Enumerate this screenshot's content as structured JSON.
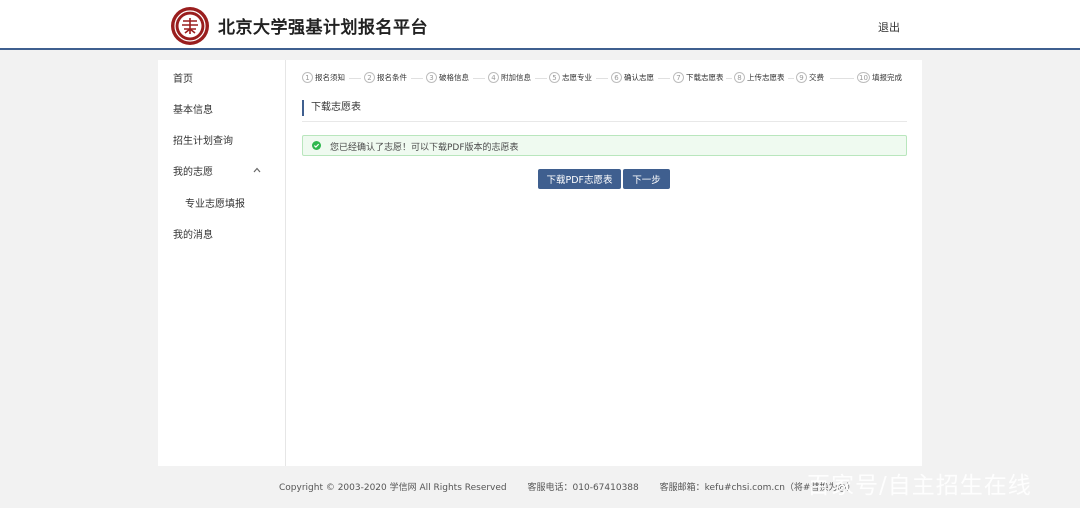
{
  "header": {
    "logo_icon": "pku-seal-icon",
    "title": "北京大学强基计划报名平台",
    "logout_label": "退出",
    "brand_color": "#3f5f8f",
    "seal_color": "#9a1e1e"
  },
  "sidebar": {
    "items": [
      {
        "label": "首页"
      },
      {
        "label": "基本信息"
      },
      {
        "label": "招生计划查询"
      },
      {
        "label": "我的志愿"
      },
      {
        "label": "专业志愿填报"
      },
      {
        "label": "我的消息"
      }
    ],
    "expand_icon": "chevron-up-icon"
  },
  "steps": [
    {
      "num": "1",
      "label": "报名须知"
    },
    {
      "num": "2",
      "label": "报名条件"
    },
    {
      "num": "3",
      "label": "破格信息"
    },
    {
      "num": "4",
      "label": "附加信息"
    },
    {
      "num": "5",
      "label": "志愿专业"
    },
    {
      "num": "6",
      "label": "确认志愿"
    },
    {
      "num": "7",
      "label": "下载志愿表"
    },
    {
      "num": "8",
      "label": "上传志愿表"
    },
    {
      "num": "9",
      "label": "交费"
    },
    {
      "num": "10",
      "label": "填报完成"
    }
  ],
  "main": {
    "section_title": "下载志愿表",
    "alert_icon": "check-circle-icon",
    "alert_text": "您已经确认了志愿！可以下载PDF版本的志愿表",
    "download_button": "下载PDF志愿表",
    "next_button": "下一步"
  },
  "footer": {
    "copyright": "Copyright © 2003-2020 学信网 All Rights Reserved",
    "phone": "客服电话：010-67410388",
    "email": "客服邮箱：kefu#chsi.com.cn（将#替换为@）"
  },
  "watermark": "百家号/自主招生在线"
}
